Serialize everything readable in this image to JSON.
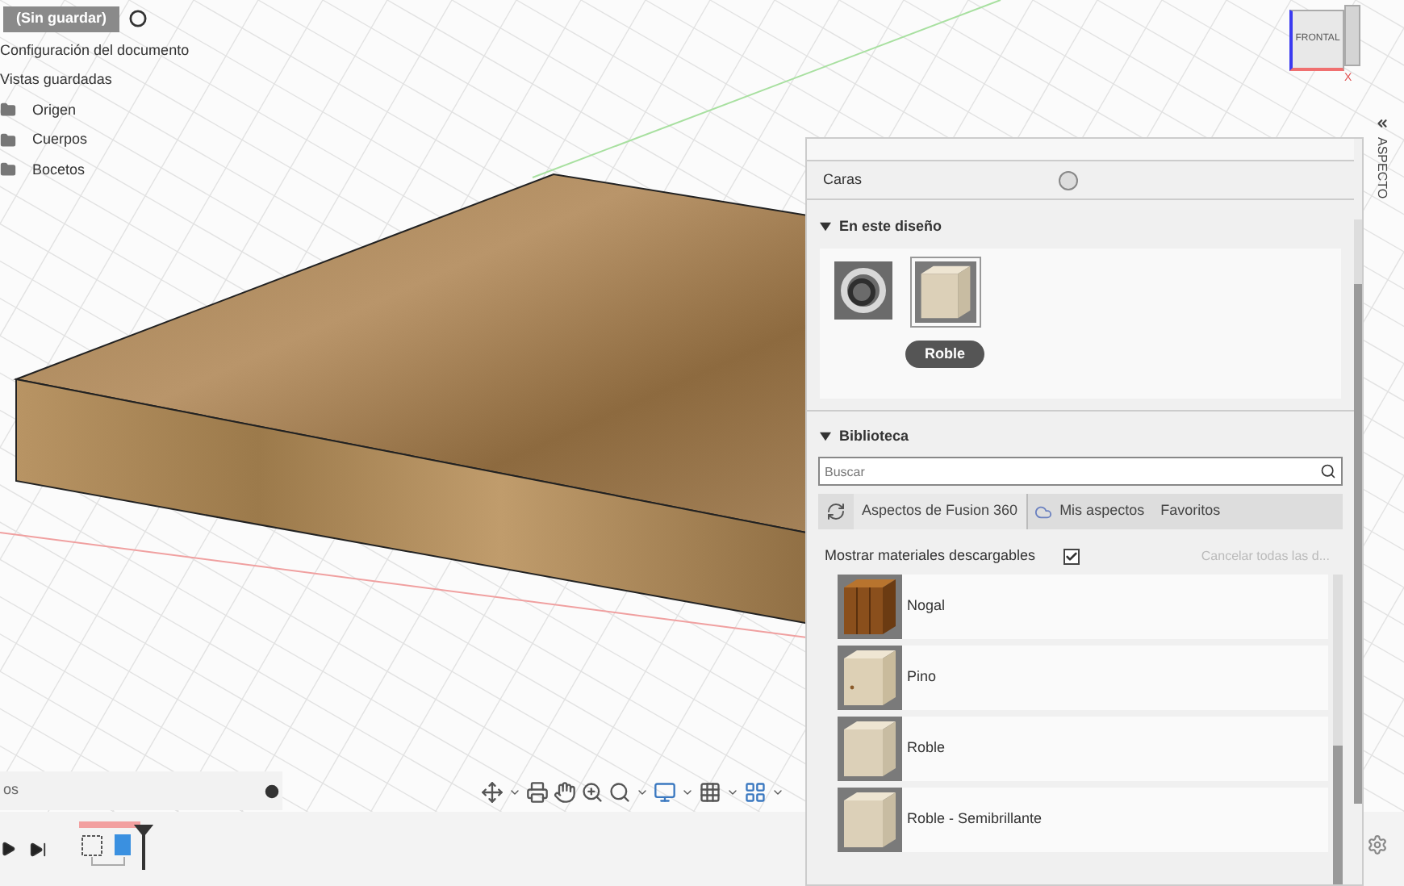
{
  "browser": {
    "document": {
      "title": "(Sin guardar)"
    },
    "items": [
      {
        "label": "Configuración del documento",
        "kind": "row"
      },
      {
        "label": "Vistas guardadas",
        "kind": "row"
      },
      {
        "label": "Origen",
        "kind": "folder"
      },
      {
        "label": "Cuerpos",
        "kind": "folder"
      },
      {
        "label": "Bocetos",
        "kind": "folder"
      }
    ]
  },
  "viewcube": {
    "face": "FRONTAL",
    "axis": "X"
  },
  "panel": {
    "side_tab": "ASPECTO",
    "target": {
      "label": "Caras",
      "selected": false
    },
    "in_design": {
      "title": "En este diseño",
      "expanded": true,
      "items": [
        {
          "kind": "metal",
          "selected": false
        },
        {
          "kind": "wood",
          "label": "Roble",
          "selected": true
        }
      ]
    },
    "library": {
      "title": "Biblioteca",
      "expanded": true,
      "search": {
        "placeholder": "Buscar"
      },
      "tabs": [
        {
          "label": "Aspectos de Fusion 360",
          "selected": true,
          "kind": "refresh"
        },
        {
          "label": "Mis aspectos",
          "selected": false,
          "kind": "cloud"
        },
        {
          "label": "Favoritos",
          "selected": false,
          "kind": "plain"
        }
      ],
      "show_downloadable": {
        "label": "Mostrar materiales descargables",
        "checked": true
      },
      "cancel_link": "Cancelar todas las d...",
      "materials": [
        {
          "name": "Nogal",
          "kind": "walnut"
        },
        {
          "name": "Pino",
          "kind": "pine"
        },
        {
          "name": "Roble",
          "kind": "oak"
        },
        {
          "name": "Roble - Semibrillante",
          "kind": "oak"
        }
      ]
    }
  },
  "comments": {
    "label": "os"
  }
}
